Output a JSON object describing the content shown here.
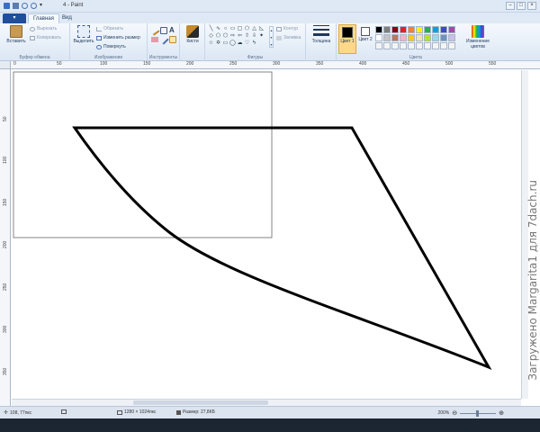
{
  "window": {
    "title": "4 - Paint",
    "controls": [
      "–",
      "□",
      "×"
    ]
  },
  "tabs": {
    "file": "▾",
    "home": "Главная",
    "view": "Вид"
  },
  "ribbon": {
    "clipboard": {
      "paste": "Вставить",
      "cut": "Вырезать",
      "copy": "Копировать",
      "label": "Буфер обмена"
    },
    "image": {
      "select": "Выделить",
      "crop": "Обрезать",
      "resize": "Изменить размер",
      "rotate": "Повернуть",
      "label": "Изображение"
    },
    "tools": {
      "label": "Инструменты"
    },
    "brushes": {
      "label": "Кисти"
    },
    "shapes": {
      "outline": "Контур",
      "fill": "Заливка",
      "label": "Фигуры"
    },
    "size": {
      "label": "Толщина"
    },
    "colors": {
      "color1": "Цвет 1",
      "color2": "Цвет 2",
      "edit": "Изменение цветов",
      "label": "Цвета",
      "color1_value": "#000000",
      "color2_value": "#ffffff",
      "palette": [
        "#000000",
        "#7f7f7f",
        "#880015",
        "#ed1c24",
        "#ff7f27",
        "#fff200",
        "#22b14c",
        "#00a2e8",
        "#3f48cc",
        "#a349a4",
        "#ffffff",
        "#c3c3c3",
        "#b97a57",
        "#ffaec9",
        "#ffc90e",
        "#efe4b0",
        "#b5e61d",
        "#99d9ea",
        "#7092be",
        "#c8bfe7",
        "#f4f4f4",
        "#f4f4f4",
        "#f4f4f4",
        "#f4f4f4",
        "#f4f4f4",
        "#f4f4f4",
        "#f4f4f4",
        "#f4f4f4",
        "#f4f4f4",
        "#f4f4f4"
      ]
    }
  },
  "rulers": {
    "horizontal": [
      "0",
      "50",
      "100",
      "150",
      "200",
      "250",
      "300",
      "350",
      "400",
      "450",
      "500",
      "550"
    ],
    "vertical": [
      "50",
      "100",
      "150",
      "200",
      "250",
      "300",
      "350"
    ]
  },
  "statusbar": {
    "cursor": "108, 77пкс",
    "dimensions": "1280 × 1024пкс",
    "filesize": "Размер: 27,8КБ",
    "zoom": "200%"
  },
  "watermark": "Загружено Margarita1 для 7dach.ru"
}
